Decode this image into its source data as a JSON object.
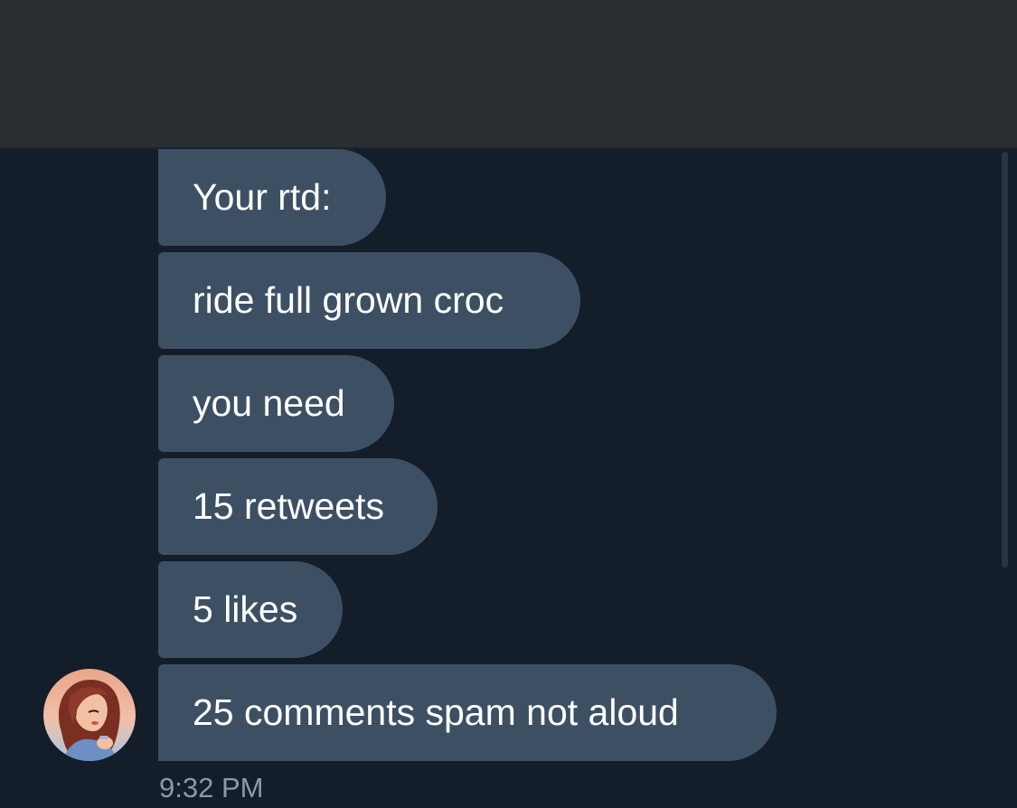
{
  "messages": [
    {
      "text": "Your rtd:"
    },
    {
      "text": "ride full grown croc"
    },
    {
      "text": "you need"
    },
    {
      "text": "15 retweets"
    },
    {
      "text": "5 likes"
    },
    {
      "text": "25 comments spam not aloud"
    }
  ],
  "timestamp": "9:32 PM",
  "colors": {
    "background": "#141d2a",
    "header": "#2a2d32",
    "bubble": "#3d5063",
    "timestamp": "#8d99a5"
  }
}
